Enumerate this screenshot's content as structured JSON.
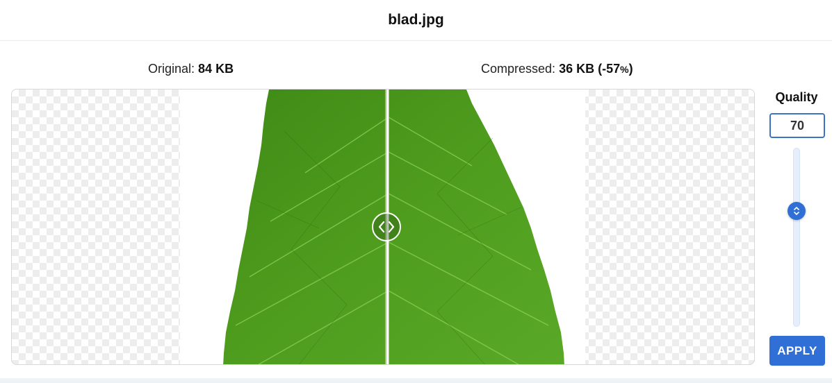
{
  "header": {
    "file_name": "blad.jpg"
  },
  "sizes": {
    "original_label": "Original:",
    "original_value": "84 KB",
    "compressed_label": "Compressed:",
    "compressed_value": "36 KB",
    "compressed_reduction_open": "(-57",
    "compressed_reduction_pct": "%",
    "compressed_reduction_close": ")"
  },
  "quality": {
    "label": "Quality",
    "value": "70",
    "slider_value_percent": 70
  },
  "actions": {
    "apply_label": "APPLY"
  },
  "colors": {
    "accent": "#2f6fd6",
    "leaf_green": "#4e9a1c"
  },
  "icons": {
    "compare_handle": "chevron-left-right-icon",
    "slider_thumb": "up-down-arrows-icon"
  }
}
